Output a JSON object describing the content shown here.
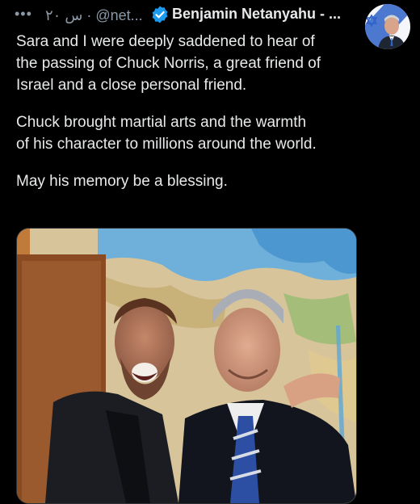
{
  "header": {
    "more_icon": "more-horizontal-icon",
    "meta": "۲۰ س · @net...",
    "verified_icon": "verified-badge-icon",
    "display_name": "Benjamin Netanyahu - ..."
  },
  "tweet": {
    "paragraphs": [
      "Sara and I were deeply saddened to hear of\nthe passing of Chuck Norris, a great friend of\nIsrael and a close personal friend.",
      "Chuck brought martial arts and the warmth\nof his character to millions around the world.",
      "May his memory be a blessing."
    ]
  },
  "colors": {
    "background": "#000000",
    "text": "#e7e9ea",
    "secondary_text": "#8b98a5",
    "verified": "#1d9bf0"
  }
}
